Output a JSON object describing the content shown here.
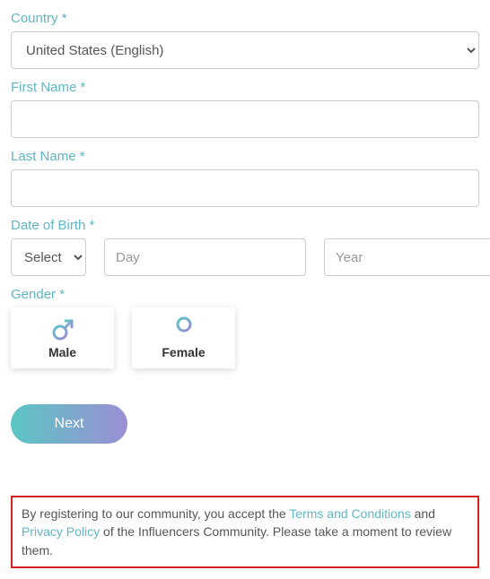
{
  "form": {
    "country": {
      "label": "Country *",
      "value": "United States (English)"
    },
    "firstName": {
      "label": "First Name *",
      "value": ""
    },
    "lastName": {
      "label": "Last Name *",
      "value": ""
    },
    "dob": {
      "label": "Date of Birth *",
      "month": {
        "selected": "Select"
      },
      "day": {
        "placeholder": "Day",
        "value": ""
      },
      "year": {
        "placeholder": "Year",
        "value": ""
      }
    },
    "gender": {
      "label": "Gender *",
      "options": {
        "male": "Male",
        "female": "Female"
      }
    },
    "nextButton": "Next"
  },
  "disclaimer": {
    "prefix": "By registering to our community, you accept the ",
    "terms": "Terms and Conditions",
    "and": " and  ",
    "privacy": "Privacy Policy",
    "suffix": " of the Influencers Community. Please take a moment to review them."
  }
}
